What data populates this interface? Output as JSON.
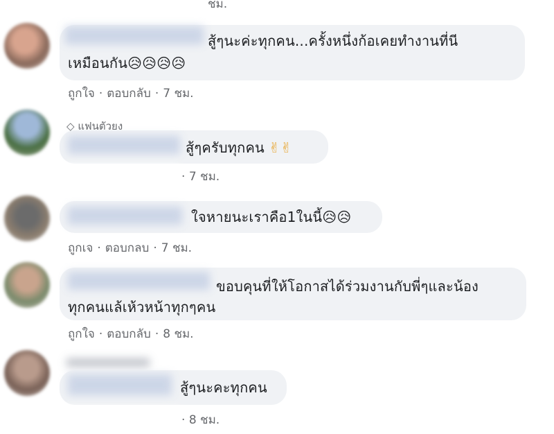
{
  "action_labels": {
    "like": "ถูกใจ",
    "reply": "ตอบกลับ",
    "reply_alt": "ตอบกลบ",
    "like_alt": "ถูกเจ",
    "separator": "·"
  },
  "comments": [
    {
      "text": "สู้ๆนะค่ะทุกคน...ครั้งหนึ่งก้อเคยทำงานที่นี",
      "text_line2": "เหมือนกัน",
      "emoji": "😥😥😥😥",
      "time": "7 ชม."
    },
    {
      "badge": "แฟนตัวยง",
      "text": "สู้ๆครับทุกคน",
      "emoji": "✌✌",
      "time": "7 ชม."
    },
    {
      "text": "ใจหายนะเราคือ1ในนี้",
      "emoji": "😥😥",
      "time": "7 ชม."
    },
    {
      "text": "ขอบคุนที่ให้โอกาสได้ร่วมงานกับพี่ๆและน้อง",
      "text_line2": "ทุกคนแล้เห้วหน้าทุกๆคน",
      "time": "8 ชม."
    },
    {
      "text": "สู้ๆนะคะทุกคน",
      "time": "8 ชม."
    }
  ],
  "top_partial_time": "ชม."
}
